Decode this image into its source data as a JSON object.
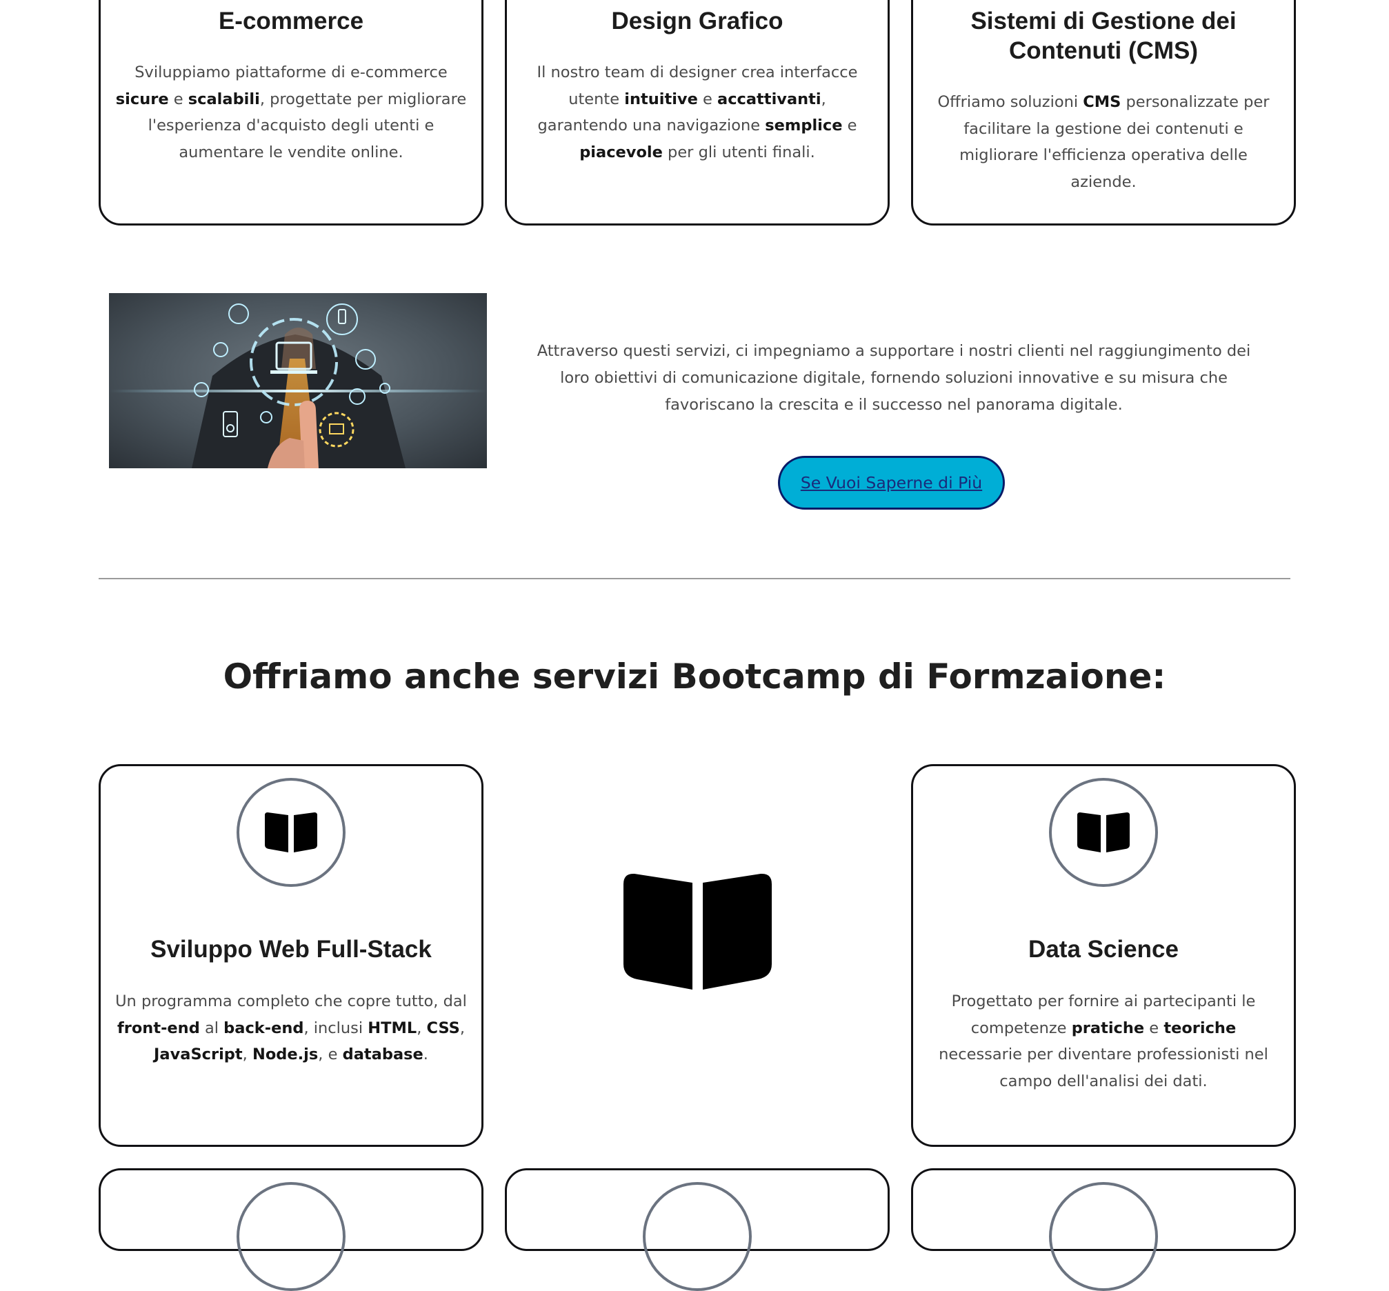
{
  "services": [
    {
      "title": "E-commerce",
      "parts": [
        {
          "t": "Sviluppiamo piattaforme di e-commerce "
        },
        {
          "t": "sicure",
          "b": true
        },
        {
          "t": " e "
        },
        {
          "t": "scalabili",
          "b": true
        },
        {
          "t": ", progettate per migliorare l'esperienza d'acquisto degli utenti e aumentare le vendite online."
        }
      ]
    },
    {
      "title": "Design Grafico",
      "parts": [
        {
          "t": "Il nostro team di designer crea interfacce utente "
        },
        {
          "t": "intuitive",
          "b": true
        },
        {
          "t": " e "
        },
        {
          "t": "accattivanti",
          "b": true
        },
        {
          "t": ", garantendo una navigazione "
        },
        {
          "t": "semplice",
          "b": true
        },
        {
          "t": " e "
        },
        {
          "t": "piacevole",
          "b": true
        },
        {
          "t": " per gli utenti finali."
        }
      ]
    },
    {
      "title": "Sistemi di Gestione dei Contenuti (CMS)",
      "parts": [
        {
          "t": "Offriamo soluzioni "
        },
        {
          "t": "CMS",
          "b": true
        },
        {
          "t": " personalizzate per facilitare la gestione dei contenuti e migliorare l'efficienza operativa delle aziende."
        }
      ]
    }
  ],
  "intro": {
    "text": "Attraverso questi servizi, ci impegniamo a supportare i nostri clienti nel raggiungimento dei loro obiettivi di comunicazione digitale, fornendo soluzioni innovative e su misura che favoriscano la crescita e il successo nel panorama digitale.",
    "button_label": "Se Vuoi Saperne di Più"
  },
  "bootcamp": {
    "heading": "Offriamo anche servizi Bootcamp di Formzaione:",
    "cards": [
      {
        "title": "Sviluppo Web Full-Stack",
        "icon": "book-icon",
        "parts": [
          {
            "t": "Un programma completo che copre tutto, dal "
          },
          {
            "t": "front-end",
            "b": true
          },
          {
            "t": " al "
          },
          {
            "t": "back-end",
            "b": true
          },
          {
            "t": ", inclusi "
          },
          {
            "t": "HTML",
            "b": true
          },
          {
            "t": ", "
          },
          {
            "t": "CSS",
            "b": true
          },
          {
            "t": ", "
          },
          {
            "t": "JavaScript",
            "b": true
          },
          {
            "t": ", "
          },
          {
            "t": "Node.js",
            "b": true
          },
          {
            "t": ", e "
          },
          {
            "t": "database",
            "b": true
          },
          {
            "t": "."
          }
        ]
      },
      {
        "title": "Data Science",
        "icon": "book-icon",
        "parts": [
          {
            "t": "Progettato per fornire ai partecipanti le competenze "
          },
          {
            "t": "pratiche",
            "b": true
          },
          {
            "t": " e "
          },
          {
            "t": "teoriche",
            "b": true
          },
          {
            "t": " necessarie per diventare professionisti nel campo dell'analisi dei dati."
          }
        ]
      }
    ]
  },
  "colors": {
    "card_border": "#111114",
    "button_bg": "#00aed6",
    "button_border": "#0a1a66",
    "icon_ring": "#6b7380"
  }
}
